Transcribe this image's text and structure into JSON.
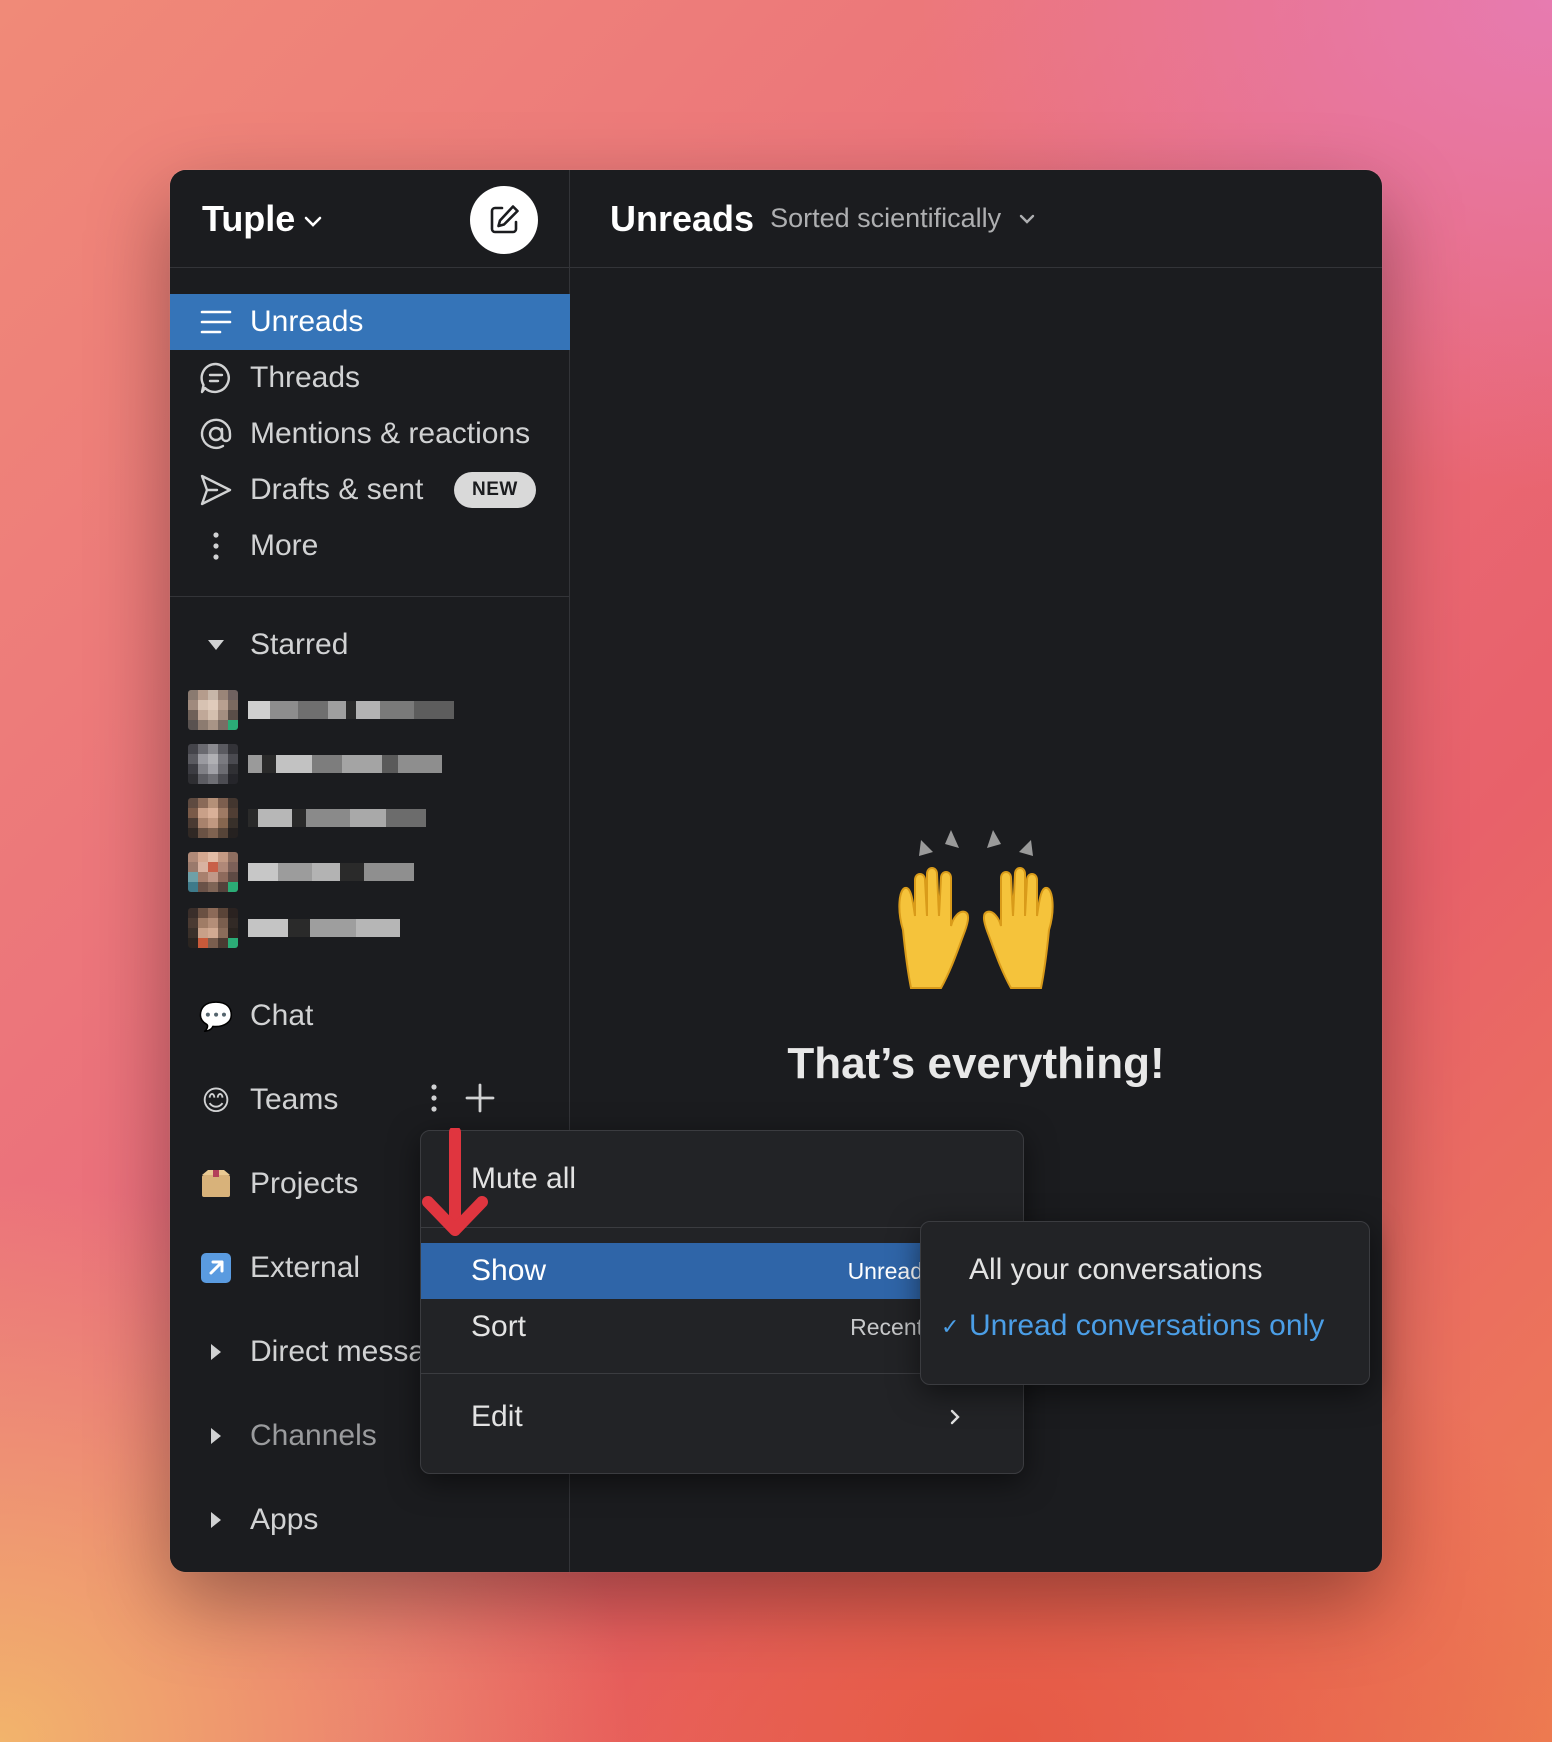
{
  "workspace": {
    "name": "Tuple"
  },
  "nav": [
    {
      "label": "Unreads",
      "icon": "list-icon",
      "active": true
    },
    {
      "label": "Threads",
      "icon": "threads-icon"
    },
    {
      "label": "Mentions & reactions",
      "icon": "at-icon"
    },
    {
      "label": "Drafts & sent",
      "icon": "send-icon",
      "badge": "NEW"
    },
    {
      "label": "More",
      "icon": "more-vertical-icon"
    }
  ],
  "sections": {
    "starred": "Starred",
    "chat": "Chat",
    "teams": "Teams",
    "projects": "Projects",
    "external": "External",
    "direct_messages": "Direct messa",
    "channels": "Channels",
    "apps": "Apps"
  },
  "main": {
    "title": "Unreads",
    "subtitle": "Sorted scientifically",
    "empty_emoji": "🙌",
    "empty_text": "That’s everything!"
  },
  "context_menu": {
    "mute_all": "Mute all",
    "show": "Show",
    "show_hint": "Unread",
    "sort": "Sort",
    "sort_hint": "Recent",
    "edit": "Edit"
  },
  "submenu": {
    "option_all": "All your conversations",
    "option_unread": "Unread conversations only",
    "selected": "Unread conversations only"
  },
  "colors": {
    "active_nav": "#3574b8",
    "menu_highlight": "#2f65a8",
    "checked": "#4b9ee6",
    "annotation_arrow": "#e0353f"
  }
}
